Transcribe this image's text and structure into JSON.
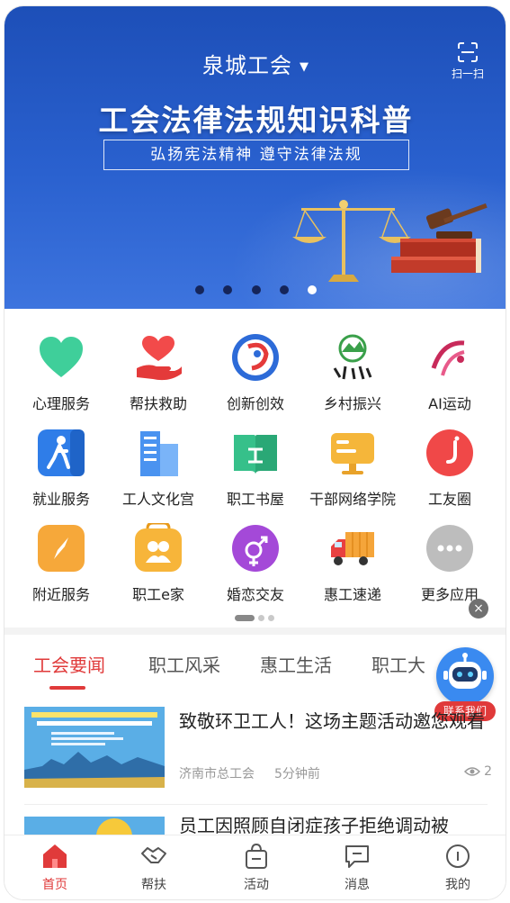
{
  "banner": {
    "org_name": "泉城工会",
    "scan_label": "扫一扫",
    "title": "工会法律法规知识科普",
    "subtitle": "弘扬宪法精神 遵守法律法规",
    "carousel_count": 5,
    "carousel_active_index": 4
  },
  "apps": [
    {
      "label": "心理服务",
      "icon": "heart-icon"
    },
    {
      "label": "帮扶救助",
      "icon": "hand-heart-icon"
    },
    {
      "label": "创新创效",
      "icon": "innovation-logo-icon"
    },
    {
      "label": "乡村振兴",
      "icon": "rural-revitalization-icon"
    },
    {
      "label": "AI运动",
      "icon": "ai-sport-icon"
    },
    {
      "label": "就业服务",
      "icon": "walking-person-icon"
    },
    {
      "label": "工人文化宫",
      "icon": "buildings-icon"
    },
    {
      "label": "职工书屋",
      "icon": "book-icon"
    },
    {
      "label": "干部网络学院",
      "icon": "monitor-icon"
    },
    {
      "label": "工友圈",
      "icon": "chat-bubble-icon"
    },
    {
      "label": "附近服务",
      "icon": "compass-icon"
    },
    {
      "label": "职工e家",
      "icon": "family-icon"
    },
    {
      "label": "婚恋交友",
      "icon": "gender-icon"
    },
    {
      "label": "惠工速递",
      "icon": "delivery-truck-icon"
    },
    {
      "label": "更多应用",
      "icon": "more-icon"
    }
  ],
  "close_symbol": "×",
  "tabs": [
    {
      "label": "工会要闻",
      "active": true
    },
    {
      "label": "职工风采",
      "active": false
    },
    {
      "label": "惠工生活",
      "active": false
    },
    {
      "label": "职工大",
      "active": false
    }
  ],
  "assistant": {
    "label": "联系我们"
  },
  "news": [
    {
      "headline": "致敬环卫工人！这场主题活动邀您观看",
      "source": "济南市总工会",
      "time": "5分钟前",
      "views": "2"
    },
    {
      "headline": "员工因照顾自闭症孩子拒绝调动被",
      "source": "",
      "time": "",
      "views": ""
    }
  ],
  "bottom_nav": [
    {
      "label": "首页",
      "icon": "home-icon",
      "active": true
    },
    {
      "label": "帮扶",
      "icon": "handshake-icon",
      "active": false
    },
    {
      "label": "活动",
      "icon": "gift-bag-icon",
      "active": false
    },
    {
      "label": "消息",
      "icon": "message-icon",
      "active": false
    },
    {
      "label": "我的",
      "icon": "profile-icon",
      "active": false
    }
  ],
  "colors": {
    "accent_red": "#e03a3a",
    "banner_blue": "#1d4fb8",
    "assistant_blue": "#3a8af0"
  }
}
